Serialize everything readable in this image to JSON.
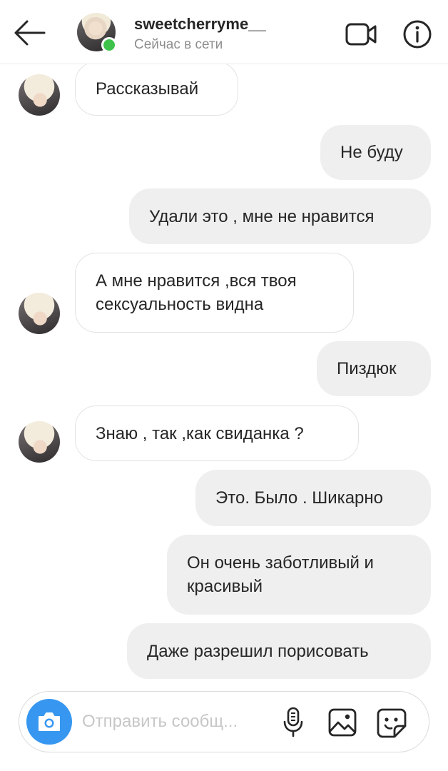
{
  "header": {
    "username": "sweetcherryme__",
    "status": "Сейчас в сети",
    "icons": [
      "back-arrow-icon",
      "video-call-icon",
      "info-icon"
    ]
  },
  "messages": [
    {
      "from": "them",
      "text": "Рассказывай"
    },
    {
      "from": "me",
      "text": "Не буду"
    },
    {
      "from": "me",
      "text": "Удали это , мне не нравится"
    },
    {
      "from": "them",
      "lines": [
        "А мне нравится ,вся твоя",
        "сексуальность видна"
      ]
    },
    {
      "from": "me",
      "text": "Пиздюк"
    },
    {
      "from": "them",
      "text": "Знаю , так ,как свиданка ?"
    },
    {
      "from": "me",
      "text": "Это. Было . Шикарно"
    },
    {
      "from": "me",
      "lines": [
        "Он очень заботливый и",
        "красивый"
      ]
    },
    {
      "from": "me",
      "text": "Даже разрешил порисовать"
    }
  ],
  "composer": {
    "placeholder": "Отправить сообщ...",
    "icons": [
      "camera-icon",
      "microphone-icon",
      "gallery-icon",
      "sticker-icon"
    ]
  },
  "colors": {
    "accent": "#3797f0",
    "online": "#3ec24a",
    "outgoing_bubble": "#efefef",
    "incoming_border": "#e3e3e3",
    "secondary_text": "#8e8e8e"
  }
}
